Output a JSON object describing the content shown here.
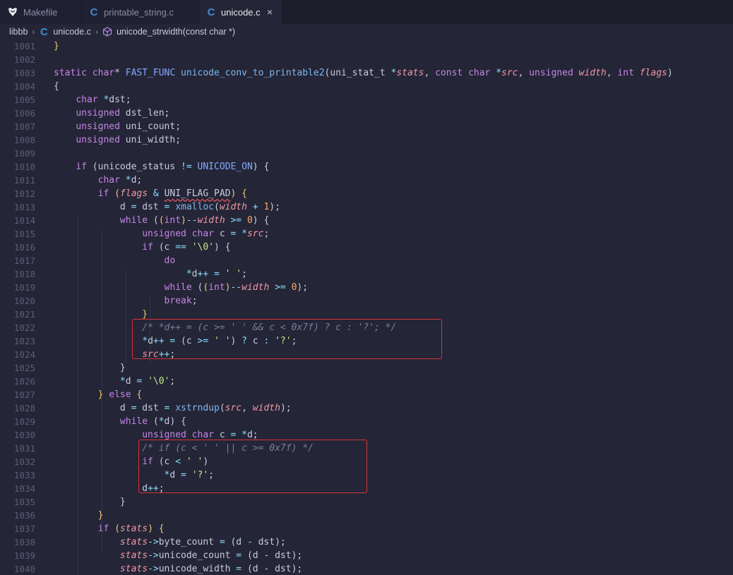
{
  "tabs": [
    {
      "label": "Makefile",
      "icon": "makefile-icon",
      "active": false
    },
    {
      "label": "printable_string.c",
      "icon": "c-file-icon",
      "active": false
    },
    {
      "label": "unicode.c",
      "icon": "c-file-icon",
      "active": true,
      "close": "×"
    }
  ],
  "breadcrumb": {
    "folder": "libbb",
    "file": "unicode.c",
    "symbol": "unicode_strwidth(const char *)"
  },
  "icons": {
    "c_letter": "C",
    "separator": "›"
  },
  "colors": {
    "background": "#242536",
    "keyword": "#c586e8",
    "function": "#7fb6f0",
    "parameter": "#f19aa6",
    "string": "#c3e88d",
    "number": "#f8a86a",
    "comment": "#7b7f97",
    "highlight_box": "#d6343a"
  },
  "code_lines": [
    {
      "n": 1001,
      "tokens": [
        [
          "hl",
          "}"
        ]
      ]
    },
    {
      "n": 1002,
      "tokens": []
    },
    {
      "n": 1003,
      "tokens": [
        [
          "kw",
          "static "
        ],
        [
          "ty",
          "char"
        ],
        [
          "pn",
          "* "
        ],
        [
          "mc",
          "FAST_FUNC "
        ],
        [
          "fn",
          "unicode_conv_to_printable2"
        ],
        [
          "pn",
          "("
        ],
        [
          "fnc",
          "uni_stat_t "
        ],
        [
          "op",
          "*"
        ],
        [
          "va",
          "stats"
        ],
        [
          "pn",
          ", "
        ],
        [
          "kw",
          "const "
        ],
        [
          "ty",
          "char "
        ],
        [
          "op",
          "*"
        ],
        [
          "va",
          "src"
        ],
        [
          "pn",
          ", "
        ],
        [
          "ty",
          "unsigned "
        ],
        [
          "va",
          "width"
        ],
        [
          "pn",
          ", "
        ],
        [
          "ty",
          "int "
        ],
        [
          "va",
          "flags"
        ],
        [
          "pn",
          ")"
        ]
      ]
    },
    {
      "n": 1004,
      "tokens": [
        [
          "pn",
          "{"
        ]
      ]
    },
    {
      "n": 1005,
      "tokens": [
        [
          "pn",
          "    "
        ],
        [
          "ty",
          "char "
        ],
        [
          "op",
          "*"
        ],
        [
          "pn",
          "dst;"
        ]
      ]
    },
    {
      "n": 1006,
      "tokens": [
        [
          "pn",
          "    "
        ],
        [
          "ty",
          "unsigned "
        ],
        [
          "pn",
          "dst_len;"
        ]
      ]
    },
    {
      "n": 1007,
      "tokens": [
        [
          "pn",
          "    "
        ],
        [
          "ty",
          "unsigned "
        ],
        [
          "pn",
          "uni_count;"
        ]
      ]
    },
    {
      "n": 1008,
      "tokens": [
        [
          "pn",
          "    "
        ],
        [
          "ty",
          "unsigned "
        ],
        [
          "pn",
          "uni_width;"
        ]
      ]
    },
    {
      "n": 1009,
      "tokens": []
    },
    {
      "n": 1010,
      "tokens": [
        [
          "pn",
          "    "
        ],
        [
          "kw",
          "if "
        ],
        [
          "pn",
          "(unicode_status "
        ],
        [
          "op",
          "!= "
        ],
        [
          "mc",
          "UNICODE_ON"
        ],
        [
          "pn",
          ") {"
        ]
      ]
    },
    {
      "n": 1011,
      "tokens": [
        [
          "pn",
          "        "
        ],
        [
          "ty",
          "char "
        ],
        [
          "op",
          "*"
        ],
        [
          "pn",
          "d;"
        ]
      ]
    },
    {
      "n": 1012,
      "tokens": [
        [
          "pn",
          "        "
        ],
        [
          "kw",
          "if "
        ],
        [
          "hl",
          "("
        ],
        [
          "va",
          "flags "
        ],
        [
          "op",
          "& "
        ],
        [
          "sq",
          "UNI_FLAG_PAD"
        ],
        [
          "hl",
          ") "
        ],
        [
          "hl",
          "{"
        ]
      ]
    },
    {
      "n": 1013,
      "tokens": [
        [
          "pn",
          "            d "
        ],
        [
          "op",
          "= "
        ],
        [
          "pn",
          "dst "
        ],
        [
          "op",
          "= "
        ],
        [
          "fn",
          "xmalloc"
        ],
        [
          "pn",
          "("
        ],
        [
          "va",
          "width "
        ],
        [
          "op",
          "+ "
        ],
        [
          "nu",
          "1"
        ],
        [
          "pn",
          ");"
        ]
      ]
    },
    {
      "n": 1014,
      "tokens": [
        [
          "pn",
          "            "
        ],
        [
          "kw",
          "while "
        ],
        [
          "pn",
          "("
        ],
        [
          "hl",
          "("
        ],
        [
          "ty",
          "int"
        ],
        [
          "hl",
          ")"
        ],
        [
          "op",
          "--"
        ],
        [
          "va",
          "width "
        ],
        [
          "op",
          ">= "
        ],
        [
          "nu",
          "0"
        ],
        [
          "pn",
          ") {"
        ]
      ]
    },
    {
      "n": 1015,
      "tokens": [
        [
          "pn",
          "                "
        ],
        [
          "ty",
          "unsigned char "
        ],
        [
          "pn",
          "c "
        ],
        [
          "op",
          "= *"
        ],
        [
          "va",
          "src"
        ],
        [
          "pn",
          ";"
        ]
      ]
    },
    {
      "n": 1016,
      "tokens": [
        [
          "pn",
          "                "
        ],
        [
          "kw",
          "if "
        ],
        [
          "pn",
          "(c "
        ],
        [
          "op",
          "== "
        ],
        [
          "st",
          "'\\0'"
        ],
        [
          "pn",
          ") {"
        ]
      ]
    },
    {
      "n": 1017,
      "tokens": [
        [
          "pn",
          "                    "
        ],
        [
          "kw",
          "do"
        ]
      ]
    },
    {
      "n": 1018,
      "tokens": [
        [
          "pn",
          "                        "
        ],
        [
          "op",
          "*"
        ],
        [
          "pn",
          "d"
        ],
        [
          "op",
          "++ = "
        ],
        [
          "st",
          "' '"
        ],
        [
          "pn",
          ";"
        ]
      ]
    },
    {
      "n": 1019,
      "tokens": [
        [
          "pn",
          "                    "
        ],
        [
          "kw",
          "while "
        ],
        [
          "pn",
          "("
        ],
        [
          "hl",
          "("
        ],
        [
          "ty",
          "int"
        ],
        [
          "hl",
          ")"
        ],
        [
          "op",
          "--"
        ],
        [
          "va",
          "width "
        ],
        [
          "op",
          ">= "
        ],
        [
          "nu",
          "0"
        ],
        [
          "pn",
          ");"
        ]
      ]
    },
    {
      "n": 1020,
      "tokens": [
        [
          "pn",
          "                    "
        ],
        [
          "kw",
          "break"
        ],
        [
          "pn",
          ";"
        ]
      ]
    },
    {
      "n": 1021,
      "tokens": [
        [
          "pn",
          "                "
        ],
        [
          "hl",
          "}"
        ]
      ]
    },
    {
      "n": 1022,
      "tokens": [
        [
          "pn",
          "                "
        ],
        [
          "cm",
          "/* *d++ = (c >= ' ' && c < 0x7f) ? c : '?'; */"
        ]
      ]
    },
    {
      "n": 1023,
      "tokens": [
        [
          "pn",
          "                "
        ],
        [
          "op",
          "*"
        ],
        [
          "pn",
          "d"
        ],
        [
          "op",
          "++ = "
        ],
        [
          "pn",
          "(c "
        ],
        [
          "op",
          ">= "
        ],
        [
          "st",
          "' '"
        ],
        [
          "pn",
          ") "
        ],
        [
          "op",
          "? "
        ],
        [
          "pn",
          "c "
        ],
        [
          "op",
          ": "
        ],
        [
          "st",
          "'?'"
        ],
        [
          "pn",
          ";"
        ]
      ]
    },
    {
      "n": 1024,
      "tokens": [
        [
          "pn",
          "                "
        ],
        [
          "va",
          "src"
        ],
        [
          "op",
          "++"
        ],
        [
          "pn",
          ";"
        ]
      ]
    },
    {
      "n": 1025,
      "tokens": [
        [
          "pn",
          "            }"
        ]
      ]
    },
    {
      "n": 1026,
      "tokens": [
        [
          "pn",
          "            "
        ],
        [
          "op",
          "*"
        ],
        [
          "pn",
          "d "
        ],
        [
          "op",
          "= "
        ],
        [
          "st",
          "'\\0'"
        ],
        [
          "pn",
          ";"
        ]
      ]
    },
    {
      "n": 1027,
      "tokens": [
        [
          "pn",
          "        "
        ],
        [
          "hl",
          "} "
        ],
        [
          "kw",
          "else "
        ],
        [
          "hl",
          "{"
        ]
      ]
    },
    {
      "n": 1028,
      "tokens": [
        [
          "pn",
          "            d "
        ],
        [
          "op",
          "= "
        ],
        [
          "pn",
          "dst "
        ],
        [
          "op",
          "= "
        ],
        [
          "fn",
          "xstrndup"
        ],
        [
          "pn",
          "("
        ],
        [
          "va",
          "src"
        ],
        [
          "pn",
          ", "
        ],
        [
          "va",
          "width"
        ],
        [
          "pn",
          ");"
        ]
      ]
    },
    {
      "n": 1029,
      "tokens": [
        [
          "pn",
          "            "
        ],
        [
          "kw",
          "while "
        ],
        [
          "pn",
          "("
        ],
        [
          "op",
          "*"
        ],
        [
          "pn",
          "d) {"
        ]
      ]
    },
    {
      "n": 1030,
      "tokens": [
        [
          "pn",
          "                "
        ],
        [
          "ty",
          "unsigned char "
        ],
        [
          "pn",
          "c "
        ],
        [
          "op",
          "= *"
        ],
        [
          "pn",
          "d;"
        ]
      ]
    },
    {
      "n": 1031,
      "tokens": [
        [
          "pn",
          "                "
        ],
        [
          "cm",
          "/* if (c < ' ' || c >= 0x7f) */"
        ]
      ]
    },
    {
      "n": 1032,
      "tokens": [
        [
          "pn",
          "                "
        ],
        [
          "kw",
          "if "
        ],
        [
          "pn",
          "(c "
        ],
        [
          "op",
          "< "
        ],
        [
          "st",
          "' '"
        ],
        [
          "pn",
          ")"
        ]
      ]
    },
    {
      "n": 1033,
      "tokens": [
        [
          "pn",
          "                    "
        ],
        [
          "op",
          "*"
        ],
        [
          "pn",
          "d "
        ],
        [
          "op",
          "= "
        ],
        [
          "st",
          "'?'"
        ],
        [
          "pn",
          ";"
        ]
      ]
    },
    {
      "n": 1034,
      "tokens": [
        [
          "pn",
          "                d"
        ],
        [
          "op",
          "++"
        ],
        [
          "pn",
          ";"
        ]
      ]
    },
    {
      "n": 1035,
      "tokens": [
        [
          "pn",
          "            }"
        ]
      ]
    },
    {
      "n": 1036,
      "tokens": [
        [
          "pn",
          "        "
        ],
        [
          "hl",
          "}"
        ]
      ]
    },
    {
      "n": 1037,
      "tokens": [
        [
          "pn",
          "        "
        ],
        [
          "kw",
          "if "
        ],
        [
          "hl",
          "("
        ],
        [
          "va",
          "stats"
        ],
        [
          "hl",
          ") "
        ],
        [
          "hl",
          "{"
        ]
      ]
    },
    {
      "n": 1038,
      "tokens": [
        [
          "pn",
          "            "
        ],
        [
          "va",
          "stats"
        ],
        [
          "op",
          "->"
        ],
        [
          "pn",
          "byte_count "
        ],
        [
          "op",
          "= "
        ],
        [
          "pn",
          "(d "
        ],
        [
          "op",
          "- "
        ],
        [
          "pn",
          "dst);"
        ]
      ]
    },
    {
      "n": 1039,
      "tokens": [
        [
          "pn",
          "            "
        ],
        [
          "va",
          "stats"
        ],
        [
          "op",
          "->"
        ],
        [
          "pn",
          "unicode_count "
        ],
        [
          "op",
          "= "
        ],
        [
          "pn",
          "(d "
        ],
        [
          "op",
          "- "
        ],
        [
          "pn",
          "dst);"
        ]
      ]
    },
    {
      "n": 1040,
      "tokens": [
        [
          "pn",
          "            "
        ],
        [
          "va",
          "stats"
        ],
        [
          "op",
          "->"
        ],
        [
          "pn",
          "unicode_width "
        ],
        [
          "op",
          "= "
        ],
        [
          "pn",
          "(d "
        ],
        [
          "op",
          "- "
        ],
        [
          "pn",
          "dst);"
        ]
      ]
    }
  ]
}
